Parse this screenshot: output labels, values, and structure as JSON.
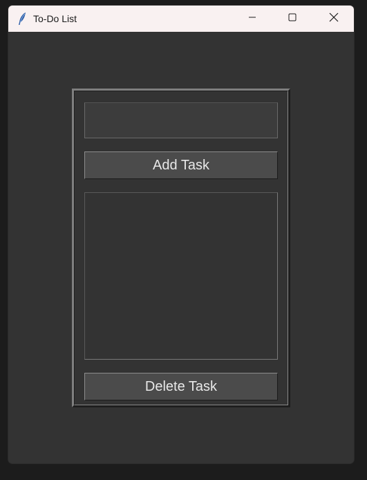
{
  "window": {
    "title": "To-Do List",
    "icon": "feather-icon"
  },
  "controls": {
    "minimize_icon": "minimize-icon",
    "maximize_icon": "maximize-icon",
    "close_icon": "close-icon"
  },
  "form": {
    "task_input_value": "",
    "add_button_label": "Add Task",
    "delete_button_label": "Delete Task",
    "tasks": []
  },
  "colors": {
    "titlebar": "#f9f1f1",
    "background": "#333333",
    "button": "#4b4b4b",
    "button_text": "#e8e8e8"
  }
}
